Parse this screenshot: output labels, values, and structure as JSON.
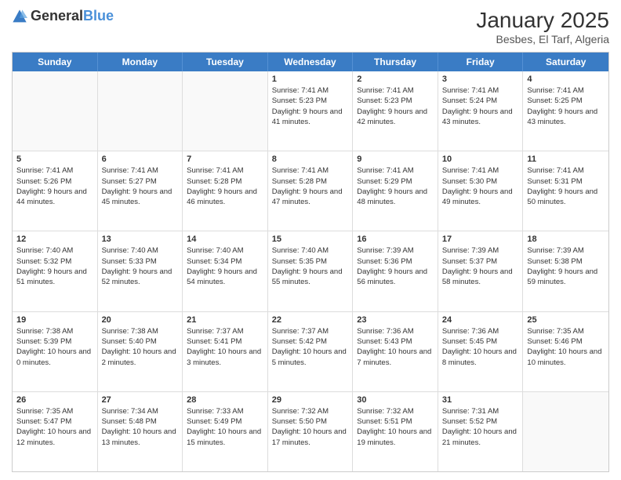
{
  "header": {
    "logo_general": "General",
    "logo_blue": "Blue",
    "title": "January 2025",
    "subtitle": "Besbes, El Tarf, Algeria"
  },
  "weekdays": [
    "Sunday",
    "Monday",
    "Tuesday",
    "Wednesday",
    "Thursday",
    "Friday",
    "Saturday"
  ],
  "rows": [
    [
      {
        "day": "",
        "info": "",
        "empty": true
      },
      {
        "day": "",
        "info": "",
        "empty": true
      },
      {
        "day": "",
        "info": "",
        "empty": true
      },
      {
        "day": "1",
        "info": "Sunrise: 7:41 AM\nSunset: 5:23 PM\nDaylight: 9 hours and 41 minutes.",
        "empty": false
      },
      {
        "day": "2",
        "info": "Sunrise: 7:41 AM\nSunset: 5:23 PM\nDaylight: 9 hours and 42 minutes.",
        "empty": false
      },
      {
        "day": "3",
        "info": "Sunrise: 7:41 AM\nSunset: 5:24 PM\nDaylight: 9 hours and 43 minutes.",
        "empty": false
      },
      {
        "day": "4",
        "info": "Sunrise: 7:41 AM\nSunset: 5:25 PM\nDaylight: 9 hours and 43 minutes.",
        "empty": false
      }
    ],
    [
      {
        "day": "5",
        "info": "Sunrise: 7:41 AM\nSunset: 5:26 PM\nDaylight: 9 hours and 44 minutes.",
        "empty": false
      },
      {
        "day": "6",
        "info": "Sunrise: 7:41 AM\nSunset: 5:27 PM\nDaylight: 9 hours and 45 minutes.",
        "empty": false
      },
      {
        "day": "7",
        "info": "Sunrise: 7:41 AM\nSunset: 5:28 PM\nDaylight: 9 hours and 46 minutes.",
        "empty": false
      },
      {
        "day": "8",
        "info": "Sunrise: 7:41 AM\nSunset: 5:28 PM\nDaylight: 9 hours and 47 minutes.",
        "empty": false
      },
      {
        "day": "9",
        "info": "Sunrise: 7:41 AM\nSunset: 5:29 PM\nDaylight: 9 hours and 48 minutes.",
        "empty": false
      },
      {
        "day": "10",
        "info": "Sunrise: 7:41 AM\nSunset: 5:30 PM\nDaylight: 9 hours and 49 minutes.",
        "empty": false
      },
      {
        "day": "11",
        "info": "Sunrise: 7:41 AM\nSunset: 5:31 PM\nDaylight: 9 hours and 50 minutes.",
        "empty": false
      }
    ],
    [
      {
        "day": "12",
        "info": "Sunrise: 7:40 AM\nSunset: 5:32 PM\nDaylight: 9 hours and 51 minutes.",
        "empty": false
      },
      {
        "day": "13",
        "info": "Sunrise: 7:40 AM\nSunset: 5:33 PM\nDaylight: 9 hours and 52 minutes.",
        "empty": false
      },
      {
        "day": "14",
        "info": "Sunrise: 7:40 AM\nSunset: 5:34 PM\nDaylight: 9 hours and 54 minutes.",
        "empty": false
      },
      {
        "day": "15",
        "info": "Sunrise: 7:40 AM\nSunset: 5:35 PM\nDaylight: 9 hours and 55 minutes.",
        "empty": false
      },
      {
        "day": "16",
        "info": "Sunrise: 7:39 AM\nSunset: 5:36 PM\nDaylight: 9 hours and 56 minutes.",
        "empty": false
      },
      {
        "day": "17",
        "info": "Sunrise: 7:39 AM\nSunset: 5:37 PM\nDaylight: 9 hours and 58 minutes.",
        "empty": false
      },
      {
        "day": "18",
        "info": "Sunrise: 7:39 AM\nSunset: 5:38 PM\nDaylight: 9 hours and 59 minutes.",
        "empty": false
      }
    ],
    [
      {
        "day": "19",
        "info": "Sunrise: 7:38 AM\nSunset: 5:39 PM\nDaylight: 10 hours and 0 minutes.",
        "empty": false
      },
      {
        "day": "20",
        "info": "Sunrise: 7:38 AM\nSunset: 5:40 PM\nDaylight: 10 hours and 2 minutes.",
        "empty": false
      },
      {
        "day": "21",
        "info": "Sunrise: 7:37 AM\nSunset: 5:41 PM\nDaylight: 10 hours and 3 minutes.",
        "empty": false
      },
      {
        "day": "22",
        "info": "Sunrise: 7:37 AM\nSunset: 5:42 PM\nDaylight: 10 hours and 5 minutes.",
        "empty": false
      },
      {
        "day": "23",
        "info": "Sunrise: 7:36 AM\nSunset: 5:43 PM\nDaylight: 10 hours and 7 minutes.",
        "empty": false
      },
      {
        "day": "24",
        "info": "Sunrise: 7:36 AM\nSunset: 5:45 PM\nDaylight: 10 hours and 8 minutes.",
        "empty": false
      },
      {
        "day": "25",
        "info": "Sunrise: 7:35 AM\nSunset: 5:46 PM\nDaylight: 10 hours and 10 minutes.",
        "empty": false
      }
    ],
    [
      {
        "day": "26",
        "info": "Sunrise: 7:35 AM\nSunset: 5:47 PM\nDaylight: 10 hours and 12 minutes.",
        "empty": false
      },
      {
        "day": "27",
        "info": "Sunrise: 7:34 AM\nSunset: 5:48 PM\nDaylight: 10 hours and 13 minutes.",
        "empty": false
      },
      {
        "day": "28",
        "info": "Sunrise: 7:33 AM\nSunset: 5:49 PM\nDaylight: 10 hours and 15 minutes.",
        "empty": false
      },
      {
        "day": "29",
        "info": "Sunrise: 7:32 AM\nSunset: 5:50 PM\nDaylight: 10 hours and 17 minutes.",
        "empty": false
      },
      {
        "day": "30",
        "info": "Sunrise: 7:32 AM\nSunset: 5:51 PM\nDaylight: 10 hours and 19 minutes.",
        "empty": false
      },
      {
        "day": "31",
        "info": "Sunrise: 7:31 AM\nSunset: 5:52 PM\nDaylight: 10 hours and 21 minutes.",
        "empty": false
      },
      {
        "day": "",
        "info": "",
        "empty": true
      }
    ]
  ]
}
